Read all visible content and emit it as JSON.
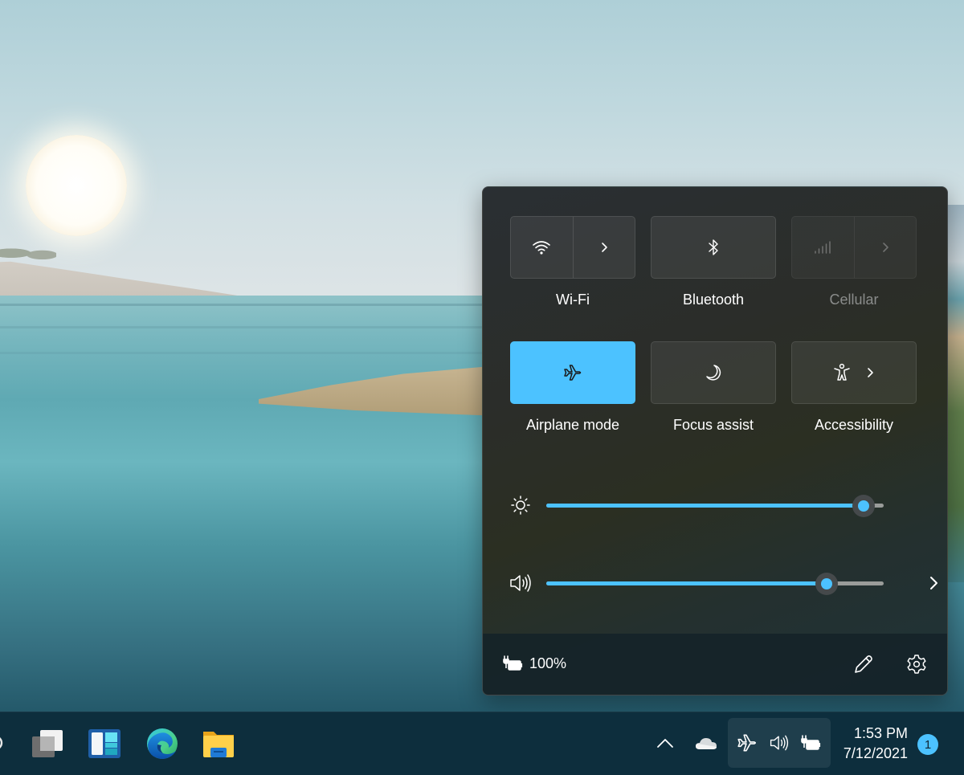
{
  "colors": {
    "accent": "#4cc2ff",
    "panel_bg": "#2b2d29",
    "taskbar_bg": "#0d2e3d"
  },
  "quick_settings": {
    "tiles": [
      {
        "id": "wifi",
        "label": "Wi-Fi",
        "icon": "wifi-icon",
        "active": false,
        "disabled": false,
        "has_expand": true
      },
      {
        "id": "bluetooth",
        "label": "Bluetooth",
        "icon": "bluetooth-icon",
        "active": false,
        "disabled": false,
        "has_expand": false
      },
      {
        "id": "cellular",
        "label": "Cellular",
        "icon": "cellular-signal-icon",
        "active": false,
        "disabled": true,
        "has_expand": true
      },
      {
        "id": "airplane",
        "label": "Airplane mode",
        "icon": "airplane-icon",
        "active": true,
        "disabled": false,
        "has_expand": false
      },
      {
        "id": "focus",
        "label": "Focus assist",
        "icon": "moon-icon",
        "active": false,
        "disabled": false,
        "has_expand": false
      },
      {
        "id": "accessibility",
        "label": "Accessibility",
        "icon": "accessibility-icon",
        "active": false,
        "disabled": false,
        "has_expand": true
      }
    ],
    "sliders": {
      "brightness": {
        "icon": "brightness-sun-icon",
        "value": 0.94
      },
      "volume": {
        "icon": "speaker-icon",
        "value": 0.83
      }
    },
    "footer": {
      "battery_text": "100%",
      "battery_icon": "battery-charging-icon",
      "edit_icon": "pencil-icon",
      "settings_icon": "gear-icon"
    }
  },
  "taskbar": {
    "apps": [
      {
        "name": "task-view",
        "icon": "task-view-icon"
      },
      {
        "name": "widgets",
        "icon": "widgets-icon"
      },
      {
        "name": "edge",
        "icon": "edge-browser-icon"
      },
      {
        "name": "file-explorer",
        "icon": "folder-icon"
      }
    ],
    "tray": {
      "overflow_icon": "chevron-up-icon",
      "onedrive_icon": "cloud-icon",
      "status_icons": [
        "airplane-icon",
        "speaker-icon",
        "battery-charging-icon"
      ]
    },
    "clock": {
      "time": "1:53 PM",
      "date": "7/12/2021"
    },
    "notification_count": "1"
  }
}
